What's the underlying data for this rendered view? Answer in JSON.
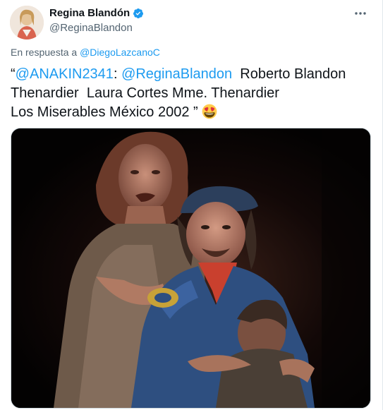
{
  "author": {
    "name": "Regina Blandón",
    "handle": "@ReginaBlandon",
    "verified": true
  },
  "reply": {
    "prefix": "En respuesta a ",
    "to": "@DiegoLazcanoC"
  },
  "tweet": {
    "open_quote": "“",
    "mention1": "@ANAKIN2341",
    "sep": ": ",
    "mention2": "@ReginaBlandon",
    "line1_rest": "  Roberto Blandon",
    "line2": "Thenardier  Laura Cortes Mme. Thenardier",
    "line3": "Los Miserables México 2002 ” "
  },
  "media": {
    "description": "stage-photo"
  },
  "colors": {
    "link": "#1d9bf0",
    "verified": "#1d9bf0",
    "text": "#0f1419",
    "muted": "#536471"
  },
  "icons": {
    "verified": "verified-badge-icon",
    "more": "more-options-icon",
    "emoji": "heart-eyes-emoji-icon"
  }
}
